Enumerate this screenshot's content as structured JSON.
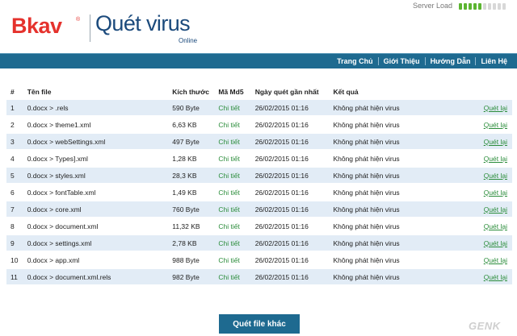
{
  "brand": {
    "logo_text": "Bkav",
    "logo_tm": "®",
    "title": "Quét virus",
    "subtitle": "Online",
    "accent": "#e5322d",
    "primary": "#1e6a90"
  },
  "server": {
    "label": "Server Load",
    "segments_total": 10,
    "segments_active": 5
  },
  "nav": {
    "items": [
      {
        "label": "Trang Chủ"
      },
      {
        "label": "Giới Thiệu"
      },
      {
        "label": "Hướng Dẫn"
      },
      {
        "label": "Liên Hệ"
      }
    ]
  },
  "table": {
    "headers": {
      "num": "#",
      "name": "Tên file",
      "size": "Kích thước",
      "md5": "Mã Md5",
      "date": "Ngày quét gần nhất",
      "result": "Kết quả"
    },
    "rows": [
      {
        "num": "1",
        "name": "0.docx > .rels",
        "size": "590 Byte",
        "md5": "Chi tiết",
        "date": "26/02/2015 01:16",
        "result": "Không phát hiện virus",
        "action": "Quét lại"
      },
      {
        "num": "2",
        "name": "0.docx > theme1.xml",
        "size": "6,63 KB",
        "md5": "Chi tiết",
        "date": "26/02/2015 01:16",
        "result": "Không phát hiện virus",
        "action": "Quét lại"
      },
      {
        "num": "3",
        "name": "0.docx > webSettings.xml",
        "size": "497 Byte",
        "md5": "Chi tiết",
        "date": "26/02/2015 01:16",
        "result": "Không phát hiện virus",
        "action": "Quét lại"
      },
      {
        "num": "4",
        "name": "0.docx > Types].xml",
        "size": "1,28 KB",
        "md5": "Chi tiết",
        "date": "26/02/2015 01:16",
        "result": "Không phát hiện virus",
        "action": "Quét lại"
      },
      {
        "num": "5",
        "name": "0.docx > styles.xml",
        "size": "28,3 KB",
        "md5": "Chi tiết",
        "date": "26/02/2015 01:16",
        "result": "Không phát hiện virus",
        "action": "Quét lại"
      },
      {
        "num": "6",
        "name": "0.docx > fontTable.xml",
        "size": "1,49 KB",
        "md5": "Chi tiết",
        "date": "26/02/2015 01:16",
        "result": "Không phát hiện virus",
        "action": "Quét lại"
      },
      {
        "num": "7",
        "name": "0.docx > core.xml",
        "size": "760 Byte",
        "md5": "Chi tiết",
        "date": "26/02/2015 01:16",
        "result": "Không phát hiện virus",
        "action": "Quét lại"
      },
      {
        "num": "8",
        "name": "0.docx > document.xml",
        "size": "11,32 KB",
        "md5": "Chi tiết",
        "date": "26/02/2015 01:16",
        "result": "Không phát hiện virus",
        "action": "Quét lại"
      },
      {
        "num": "9",
        "name": "0.docx > settings.xml",
        "size": "2,78 KB",
        "md5": "Chi tiết",
        "date": "26/02/2015 01:16",
        "result": "Không phát hiện virus",
        "action": "Quét lại"
      },
      {
        "num": "10",
        "name": "0.docx > app.xml",
        "size": "988 Byte",
        "md5": "Chi tiết",
        "date": "26/02/2015 01:16",
        "result": "Không phát hiện virus",
        "action": "Quét lại"
      },
      {
        "num": "11",
        "name": "0.docx > document.xml.rels",
        "size": "982 Byte",
        "md5": "Chi tiết",
        "date": "26/02/2015 01:16",
        "result": "Không phát hiện virus",
        "action": "Quét lại"
      }
    ]
  },
  "actions": {
    "scan_other": "Quét file khác"
  },
  "watermark": "GENK"
}
